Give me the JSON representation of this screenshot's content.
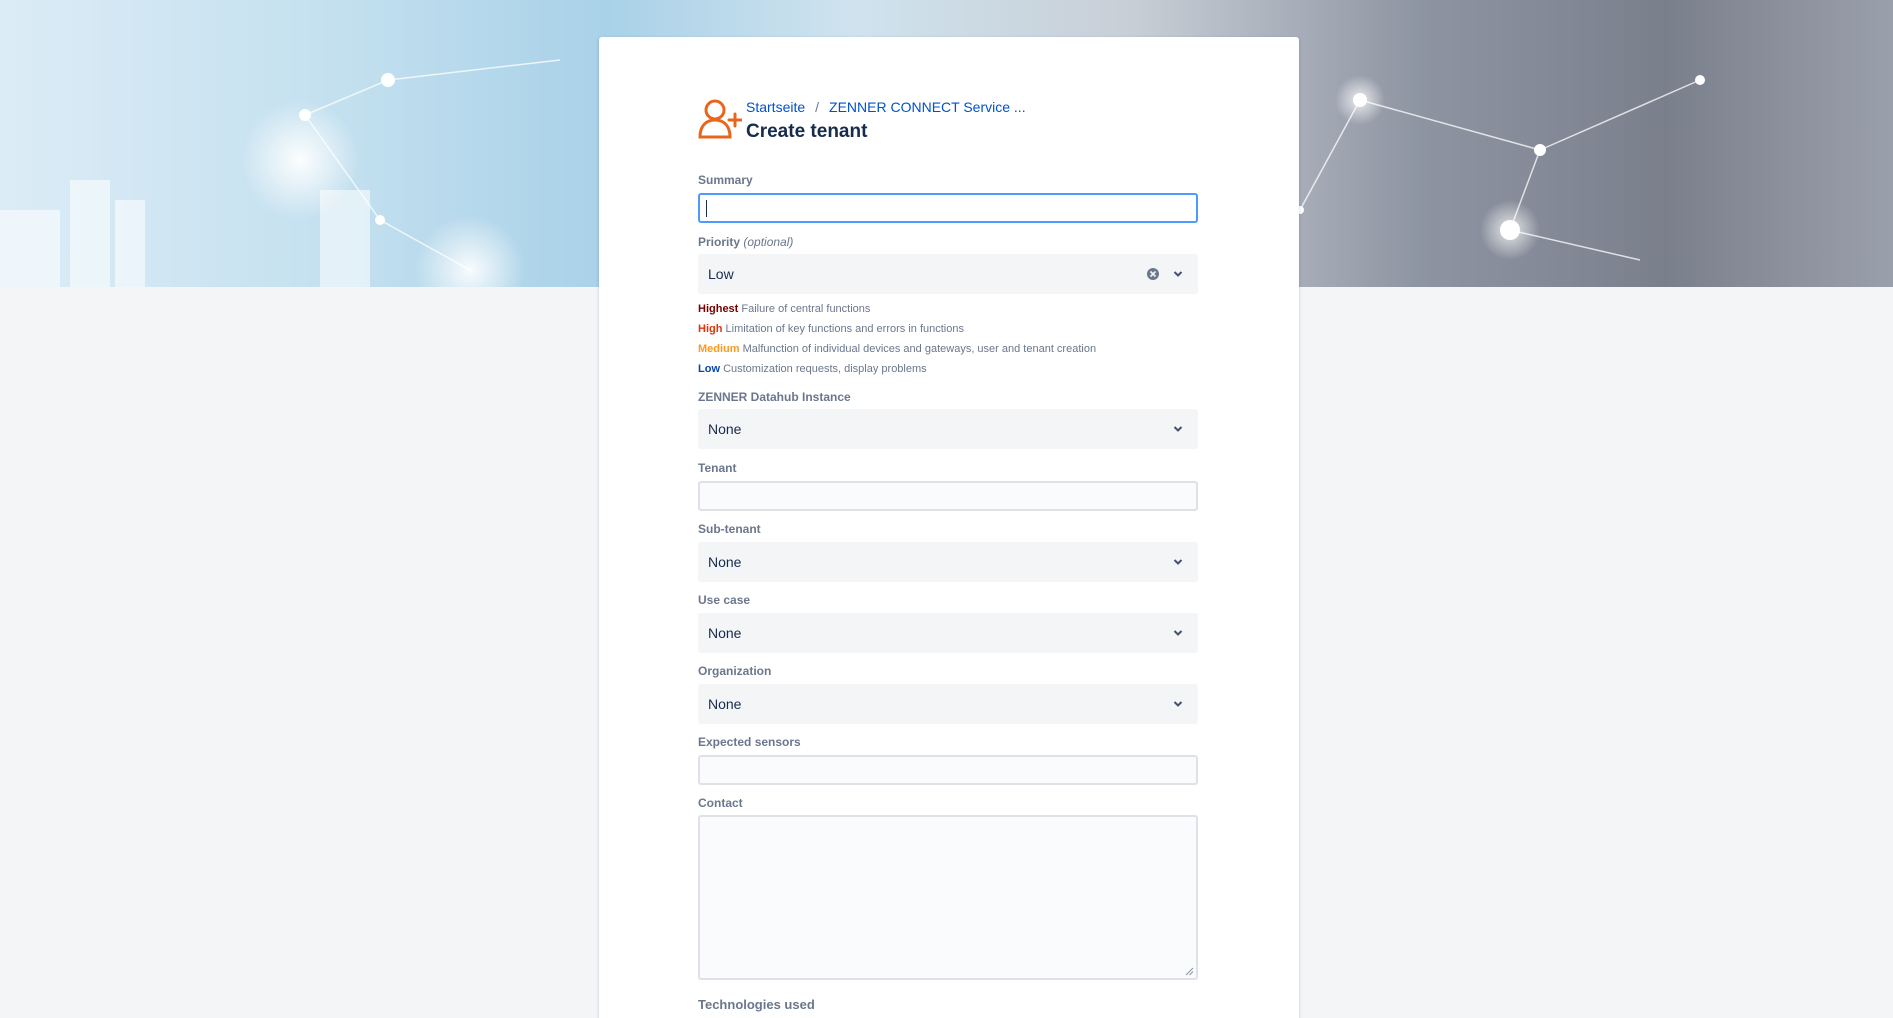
{
  "breadcrumb": {
    "home": "Startseite",
    "separator": "/",
    "project": "ZENNER CONNECT Service ..."
  },
  "page_title": "Create tenant",
  "icons": {
    "header": "add-user-icon",
    "dropdown": "chevron-down-icon",
    "clear": "clear-icon"
  },
  "colors": {
    "accent": "#0052cc",
    "focus": "#4c9aff",
    "icon": "#e8661c",
    "highest": "#7a0000",
    "high": "#de350b",
    "medium": "#ff991f",
    "low": "#0747a6"
  },
  "fields": {
    "summary": {
      "label": "Summary",
      "value": ""
    },
    "priority": {
      "label": "Priority",
      "optional": "(optional)",
      "value": "Low"
    },
    "datahub": {
      "label": "ZENNER Datahub Instance",
      "value": "None"
    },
    "tenant": {
      "label": "Tenant",
      "value": ""
    },
    "subtenant": {
      "label": "Sub-tenant",
      "value": "None"
    },
    "usecase": {
      "label": "Use case",
      "value": "None"
    },
    "organization": {
      "label": "Organization",
      "value": "None"
    },
    "sensors": {
      "label": "Expected sensors",
      "value": ""
    },
    "contact": {
      "label": "Contact",
      "value": ""
    },
    "technologies": {
      "label": "Technologies used"
    }
  },
  "priority_legend": [
    {
      "level": "Highest",
      "text": "Failure of central functions"
    },
    {
      "level": "High",
      "text": "Limitation of key functions and errors in functions"
    },
    {
      "level": "Medium",
      "text": "Malfunction of individual devices and gateways, user and tenant creation"
    },
    {
      "level": "Low",
      "text": "Customization requests, display problems"
    }
  ]
}
